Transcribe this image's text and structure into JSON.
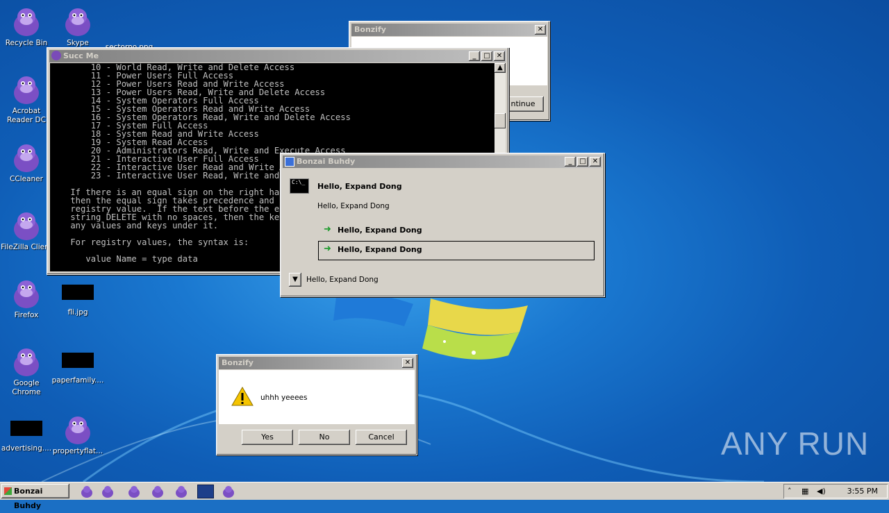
{
  "desktop": {
    "icons": [
      {
        "label": "Recycle Bin",
        "kind": "bonzi"
      },
      {
        "label": "Skype",
        "kind": "bonzi"
      },
      {
        "label": "sectorno.png",
        "kind": "none"
      },
      {
        "label": "Acrobat Reader DC",
        "kind": "bonzi"
      },
      {
        "label": "CCleaner",
        "kind": "bonzi"
      },
      {
        "label": "FileZilla Client",
        "kind": "bonzi"
      },
      {
        "label": "Firefox",
        "kind": "bonzi"
      },
      {
        "label": "fli.jpg",
        "kind": "black"
      },
      {
        "label": "Google Chrome",
        "kind": "bonzi"
      },
      {
        "label": "paperfamily....",
        "kind": "black"
      },
      {
        "label": "advertising....",
        "kind": "black"
      },
      {
        "label": "propertyflat...",
        "kind": "bonzi"
      }
    ],
    "watermark": "ANY RUN"
  },
  "succ_window": {
    "title": "Succ Me",
    "lines": [
      "        10 - World Read, Write and Delete Access",
      "        11 - Power Users Full Access",
      "        12 - Power Users Read and Write Access",
      "        13 - Power Users Read, Write and Delete Access",
      "        14 - System Operators Full Access",
      "        15 - System Operators Read and Write Access",
      "        16 - System Operators Read, Write and Delete Access",
      "        17 - System Full Access",
      "        18 - System Read and Write Access",
      "        19 - System Read Access",
      "        20 - Administrators Read, Write and Execute Access",
      "        21 - Interactive User Full Access",
      "        22 - Interactive User Read and Write Access",
      "        23 - Interactive User Read, Write and Delete Access",
      "",
      "    If there is an equal sign on the right hand side of an equal sign,",
      "    then the equal sign takes precedence and is treated as part of the",
      "    registry value.  If the text before the equal sign is the",
      "    string DELETE with no spaces, then the key is deleted along with",
      "    any values and keys under it.",
      "",
      "    For registry values, the syntax is:",
      "",
      "       value Name = type data"
    ]
  },
  "bonzify_back": {
    "title": "Bonzify",
    "button": "ntinue"
  },
  "bonzai_window": {
    "title": "Bonzai Buhdy",
    "heading": "Hello, Expand Dong",
    "subtext": "Hello, Expand Dong",
    "option1": "Hello, Expand Dong",
    "option2": "Hello, Expand Dong",
    "footer": "Hello, Expand Dong"
  },
  "bonzify_dialog": {
    "title": "Bonzify",
    "message": "uhhh yeeees",
    "yes": "Yes",
    "no": "No",
    "cancel": "Cancel"
  },
  "taskbar": {
    "start_label": "Bonzai Buhdy",
    "time": "3:55 PM"
  }
}
